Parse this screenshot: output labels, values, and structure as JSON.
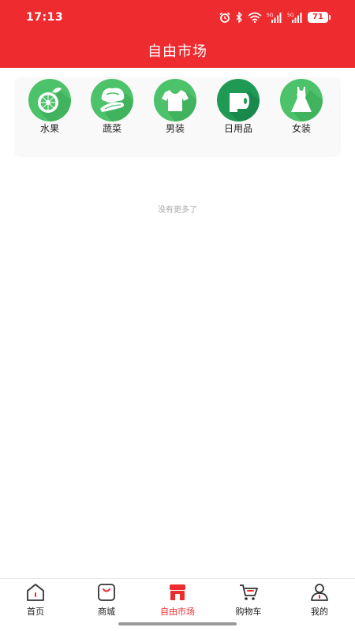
{
  "status_bar": {
    "time": "17:13",
    "battery": "71",
    "icons": [
      "alarm-icon",
      "bluetooth-icon",
      "wifi-icon",
      "signal-5g-icon",
      "signal-5g-icon",
      "battery-icon"
    ]
  },
  "header": {
    "title": "自由市场"
  },
  "categories": [
    {
      "label": "水果",
      "icon": "fruit-icon"
    },
    {
      "label": "蔬菜",
      "icon": "vegetable-icon"
    },
    {
      "label": "男装",
      "icon": "tshirt-icon"
    },
    {
      "label": "日用品",
      "icon": "toilet-paper-icon"
    },
    {
      "label": "女装",
      "icon": "dress-icon"
    }
  ],
  "list": {
    "end_text": "没有更多了"
  },
  "tabbar": {
    "items": [
      {
        "label": "首页",
        "icon": "home-icon",
        "active": false
      },
      {
        "label": "商城",
        "icon": "shopping-bag-icon",
        "active": false
      },
      {
        "label": "自由市场",
        "icon": "store-icon",
        "active": true
      },
      {
        "label": "购物车",
        "icon": "cart-icon",
        "active": false
      },
      {
        "label": "我的",
        "icon": "user-icon",
        "active": false
      }
    ]
  },
  "colors": {
    "primary": "#ee2b2f",
    "category_green": "#4cc26a",
    "text": "#222222",
    "muted": "#aaaaaa"
  }
}
